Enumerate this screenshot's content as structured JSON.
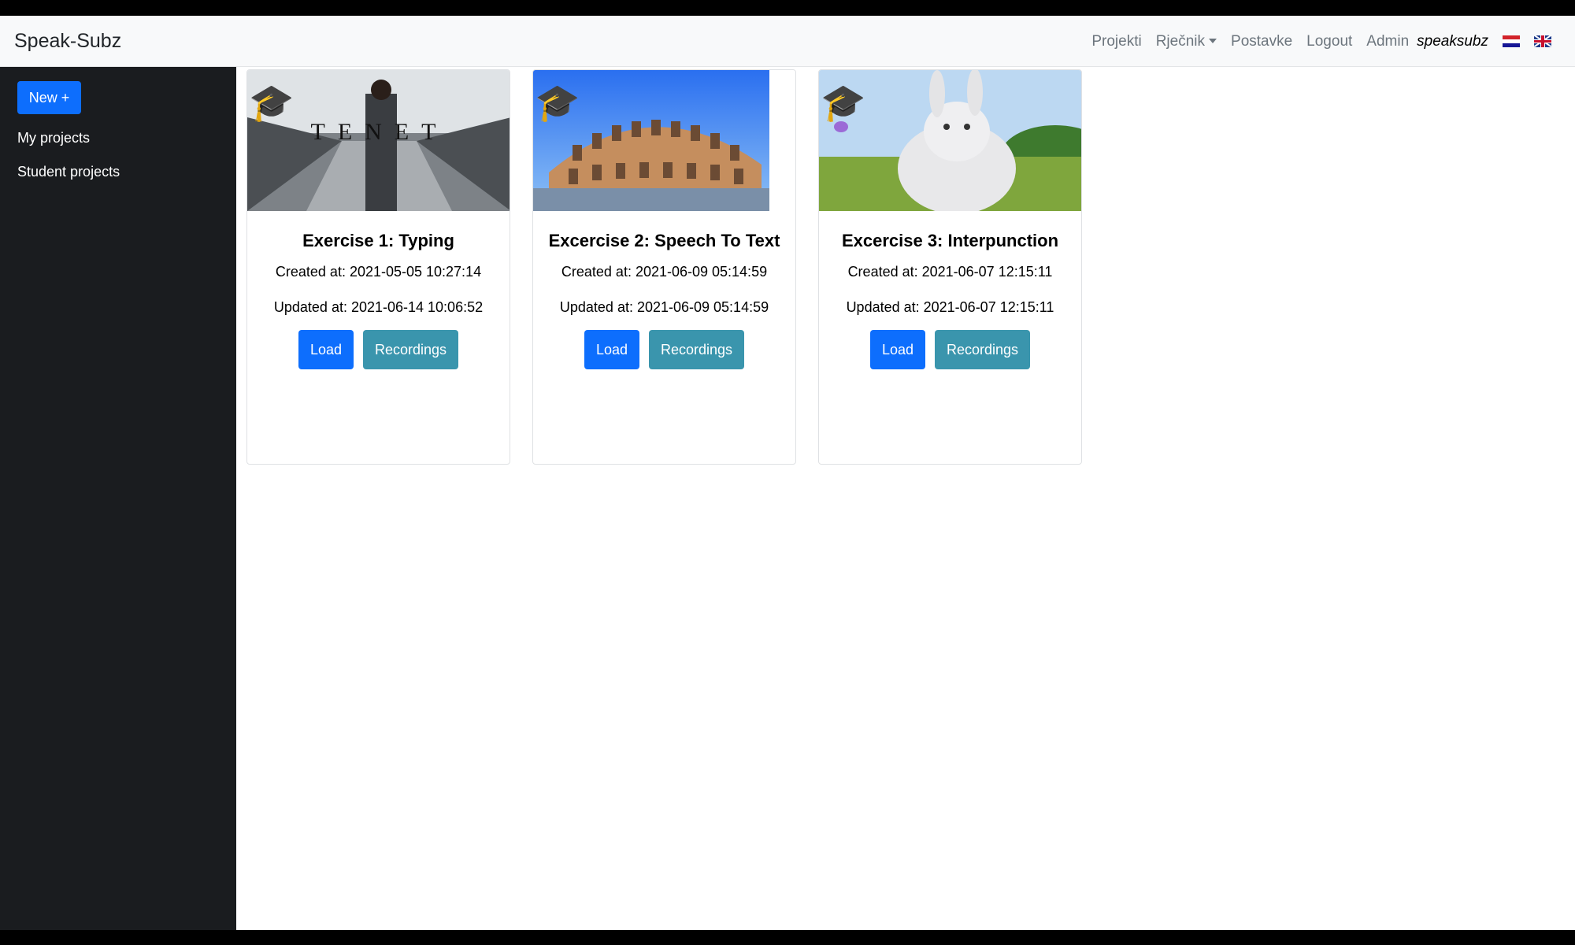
{
  "app": {
    "brand": "Speak-Subz"
  },
  "nav": {
    "projekti": "Projekti",
    "rjecnik": "Rječnik",
    "postavke": "Postavke",
    "logout": "Logout",
    "admin": "Admin",
    "username": "speaksubz",
    "flags": [
      "croatia-flag-icon",
      "uk-flag-icon"
    ]
  },
  "sidebar": {
    "new_button": "New +",
    "items": [
      "My projects",
      "Student projects"
    ]
  },
  "cards": [
    {
      "title": "Exercise 1: Typing",
      "created": "Created at: 2021-05-05 10:27:14",
      "updated": "Updated at: 2021-06-14 10:06:52",
      "load": "Load",
      "recordings": "Recordings",
      "poster_text": "TENET"
    },
    {
      "title": "Excercise 2: Speech To Text",
      "created": "Created at: 2021-06-09 05:14:59",
      "updated": "Updated at: 2021-06-09 05:14:59",
      "load": "Load",
      "recordings": "Recordings"
    },
    {
      "title": "Excercise 3: Interpunction",
      "created": "Created at: 2021-06-07 12:15:11",
      "updated": "Updated at: 2021-06-07 12:15:11",
      "load": "Load",
      "recordings": "Recordings"
    }
  ],
  "colors": {
    "primary": "#0d6efd",
    "info": "#3a95ad",
    "sidebar": "#1a1c1f",
    "navbar": "#f8f9fa"
  },
  "icons": {
    "card_badge": "graduation-cap-icon"
  }
}
